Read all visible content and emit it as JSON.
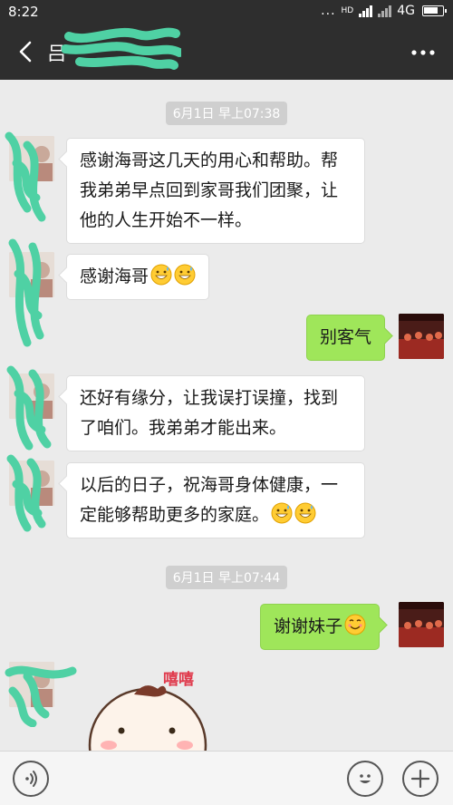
{
  "status_bar": {
    "time": "8:22",
    "dots": "...",
    "network": "4G",
    "hd_badge": "HD"
  },
  "nav": {
    "title": "吕"
  },
  "timestamps": [
    "6月1日 早上07:38",
    "6月1日 早上07:44"
  ],
  "messages": [
    {
      "side": "left",
      "text": "感谢海哥这几天的用心和帮助。帮我弟弟早点回到家哥我们团聚，让他的人生开始不一样。"
    },
    {
      "side": "left",
      "text": "感谢海哥",
      "emoji": [
        "grin-sweat-emoji",
        "grin-sweat-emoji"
      ]
    },
    {
      "side": "right",
      "text": "别客气"
    },
    {
      "side": "left",
      "text": "还好有缘分，让我误打误撞，找到了咱们。我弟弟才能出来。"
    },
    {
      "side": "left",
      "text": "以后的日子，祝海哥身体健康，一定能够帮助更多的家庭。",
      "emoji": [
        "grin-sweat-emoji",
        "grin-sweat-emoji"
      ]
    },
    {
      "side": "right",
      "text": "谢谢妹子",
      "emoji": [
        "smile-emoji"
      ]
    }
  ],
  "sticker": {
    "label": "嘻嘻",
    "icon": "baby-sticker-icon"
  },
  "input_bar": {
    "voice_icon": "voice-icon",
    "emoji_icon": "smiley-icon",
    "plus_icon": "plus-icon"
  },
  "colors": {
    "header": "#2e2e2e",
    "chat_bg": "#ebebeb",
    "bubble_sent": "#9fe65a",
    "bubble_received": "#ffffff",
    "scribble": "#4fd1a4"
  }
}
